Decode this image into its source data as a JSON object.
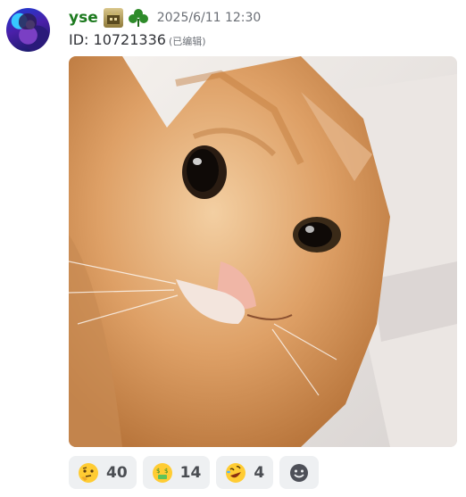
{
  "message": {
    "username": "yse",
    "timestamp": "2025/6/11 12:30",
    "content": "ID: 10721336",
    "edited_label": "(已编辑)"
  },
  "reactions": [
    {
      "emoji": "thinking-face",
      "count": "40"
    },
    {
      "emoji": "money-mouth-face",
      "count": "14"
    },
    {
      "emoji": "rolling-on-floor-laughing",
      "count": "4"
    }
  ],
  "add_reaction_icon": "add-reaction-icon",
  "colors": {
    "username": "#1d7a1f",
    "reaction_bg": "#eef0f2"
  }
}
